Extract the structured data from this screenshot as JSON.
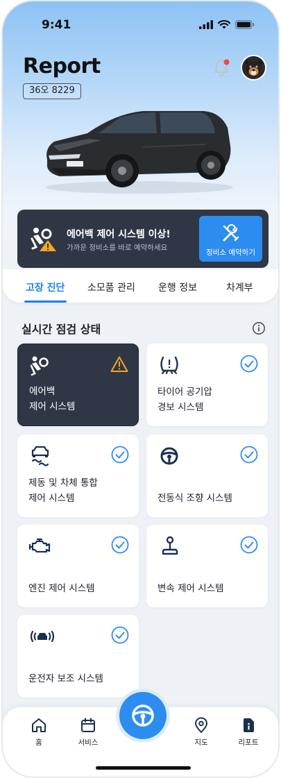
{
  "status_bar": {
    "time": "9:41"
  },
  "header": {
    "title": "Report",
    "plate": "36오 8229"
  },
  "alert": {
    "title": "에어백 제어 시스템 이상!",
    "subtitle": "가까운 정비소를 바로 예약하세요",
    "button_label": "정비소 예약하기",
    "icon": "airbag-warning-icon"
  },
  "tabs": [
    {
      "label": "고장 진단",
      "active": true
    },
    {
      "label": "소모품 관리",
      "active": false
    },
    {
      "label": "운행 정보",
      "active": false
    },
    {
      "label": "차계부",
      "active": false
    }
  ],
  "section": {
    "title": "실시간 점검 상태"
  },
  "systems": [
    {
      "label": "에어백\n제어 시스템",
      "status": "warning",
      "icon": "airbag-icon"
    },
    {
      "label": "타이어 공기압\n경보 시스템",
      "status": "ok",
      "icon": "tire-pressure-icon"
    },
    {
      "label": "제동 및 차체 통합\n제어 시스템",
      "status": "ok",
      "icon": "skid-control-icon"
    },
    {
      "label": "전동식 조향 시스템",
      "status": "ok",
      "icon": "steering-wheel-icon"
    },
    {
      "label": "엔진 제어 시스템",
      "status": "ok",
      "icon": "engine-icon"
    },
    {
      "label": "변속 제어 시스템",
      "status": "ok",
      "icon": "gear-shift-icon"
    },
    {
      "label": "운전자 보조 시스템",
      "status": "ok",
      "icon": "driver-assist-icon"
    }
  ],
  "nav": [
    {
      "label": "홈",
      "icon": "home-icon"
    },
    {
      "label": "서비스",
      "icon": "calendar-icon"
    },
    {
      "label": "",
      "icon": "steering-wheel-icon"
    },
    {
      "label": "지도",
      "icon": "map-pin-icon"
    },
    {
      "label": "리포트",
      "icon": "report-icon"
    }
  ],
  "colors": {
    "accent": "#2d8cf0",
    "dark_card": "#2f3746",
    "warning": "#f5a623",
    "notification_dot": "#f04545"
  }
}
